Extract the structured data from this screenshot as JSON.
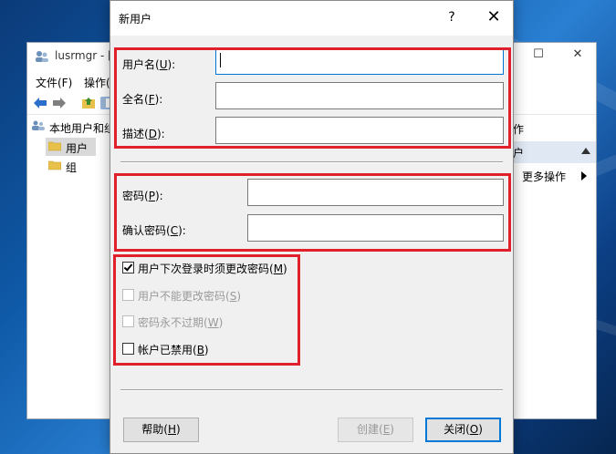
{
  "background_window": {
    "title": "lusrmgr - [",
    "menu": [
      "文件(F)",
      "操作("
    ],
    "tree": {
      "root_label": "本地用户和组",
      "items": [
        {
          "label": "用户",
          "selected": true
        },
        {
          "label": "组",
          "selected": false
        }
      ]
    },
    "actions": {
      "header": "作",
      "section": "户",
      "more_actions": "更多操作"
    }
  },
  "dialog": {
    "title": "新用户",
    "help_glyph": "?",
    "close_glyph": "✕",
    "fields": {
      "username": {
        "label": "用户名(",
        "key": "U",
        "suffix": "):",
        "value": ""
      },
      "fullname": {
        "label": "全名(",
        "key": "F",
        "suffix": "):",
        "value": ""
      },
      "description": {
        "label": "描述(",
        "key": "D",
        "suffix": "):",
        "value": ""
      },
      "password": {
        "label": "密码(",
        "key": "P",
        "suffix": "):",
        "value": ""
      },
      "confirm_password": {
        "label": "确认密码(",
        "key": "C",
        "suffix": "):",
        "value": ""
      }
    },
    "checkboxes": {
      "must_change": {
        "label": "用户下次登录时须更改密码(",
        "key": "M",
        "suffix": ")",
        "checked": true,
        "enabled": true
      },
      "cannot_change": {
        "label": "用户不能更改密码(",
        "key": "S",
        "suffix": ")",
        "checked": false,
        "enabled": false
      },
      "never_expires": {
        "label": "密码永不过期(",
        "key": "W",
        "suffix": ")",
        "checked": false,
        "enabled": false
      },
      "disabled_account": {
        "label": "帐户已禁用(",
        "key": "B",
        "suffix": ")",
        "checked": false,
        "enabled": true
      }
    },
    "buttons": {
      "help": {
        "label": "帮助(",
        "key": "H",
        "suffix": ")"
      },
      "create": {
        "label": "创建(",
        "key": "E",
        "suffix": ")"
      },
      "close": {
        "label": "关闭(",
        "key": "O",
        "suffix": ")"
      }
    },
    "highlight_color": "#e0202a"
  }
}
